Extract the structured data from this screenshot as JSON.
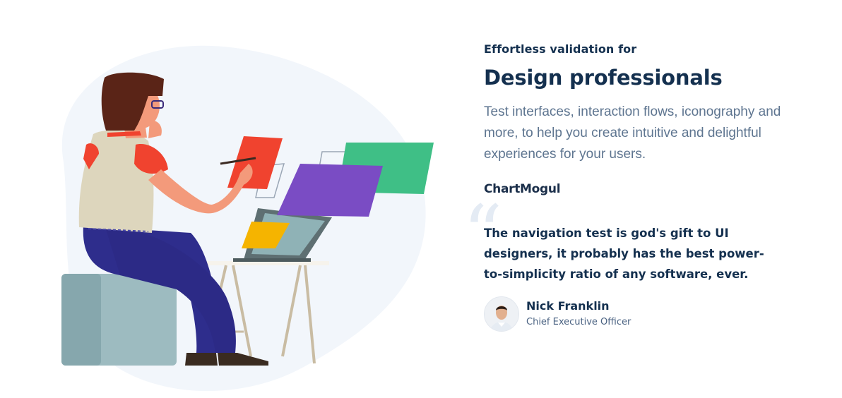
{
  "hero": {
    "eyebrow": "Effortless validation for",
    "title": "Design professionals",
    "description": "Test interfaces, interaction flows, iconography and more, to help you create intuitive and delightful experiences for your users."
  },
  "testimonial": {
    "company_logo": "ChartMogul",
    "quote_icon": "quote-icon",
    "quote": "The navigation test is god's gift to UI designers, it probably has the best power-to-simplicity ratio of any software, ever.",
    "author_name": "Nick Franklin",
    "author_title": "Chief Executive Officer"
  },
  "colors": {
    "heading": "#14304f",
    "body_text": "#5e7590",
    "blob_background": "#f2f6fb",
    "card_red": "#f0432f",
    "card_green": "#3fbf86",
    "card_purple": "#7a4cc4",
    "card_yellow": "#f5b400"
  },
  "illustration": {
    "subject": "designer-at-desk-illustration"
  }
}
